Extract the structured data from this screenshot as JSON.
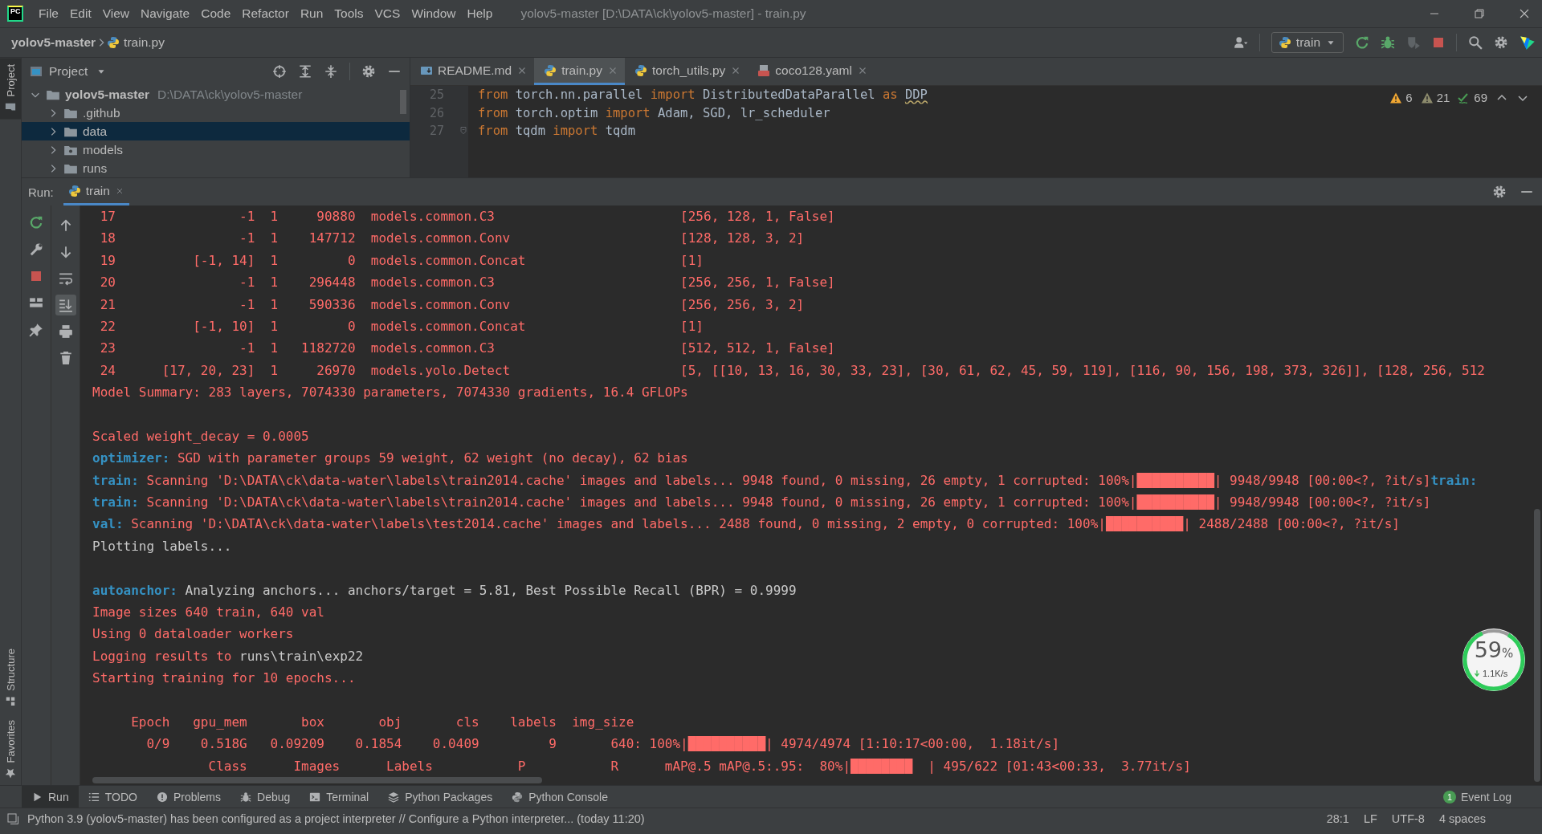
{
  "title_bar": {
    "app_icon": "PC",
    "menus": [
      "File",
      "Edit",
      "View",
      "Navigate",
      "Code",
      "Refactor",
      "Run",
      "Tools",
      "VCS",
      "Window",
      "Help"
    ],
    "title": "yolov5-master [D:\\DATA\\ck\\yolov5-master] - train.py"
  },
  "navigation_bar": {
    "project": "yolov5-master",
    "file": "train.py",
    "run_config": "train"
  },
  "side_tabs": [
    {
      "label": "Project",
      "selected": true
    },
    {
      "label": "Structure",
      "selected": false
    },
    {
      "label": "Favorites",
      "selected": false
    }
  ],
  "project_panel": {
    "title": "Project",
    "tree": [
      {
        "label": "yolov5-master",
        "path": "D:\\DATA\\ck\\yolov5-master",
        "kind": "folder",
        "expanded": true,
        "selected": false,
        "children": [
          {
            "label": ".github",
            "kind": "folder",
            "expanded": false,
            "selected": false
          },
          {
            "label": "data",
            "kind": "folder",
            "expanded": false,
            "selected": true
          },
          {
            "label": "models",
            "kind": "package",
            "expanded": false,
            "selected": false
          },
          {
            "label": "runs",
            "kind": "folder",
            "expanded": false,
            "selected": false
          }
        ]
      }
    ]
  },
  "editor": {
    "tabs": [
      {
        "label": "README.md",
        "kind": "markdown",
        "selected": false
      },
      {
        "label": "train.py",
        "kind": "python",
        "selected": true
      },
      {
        "label": "torch_utils.py",
        "kind": "python",
        "selected": false
      },
      {
        "label": "coco128.yaml",
        "kind": "yaml",
        "selected": false
      }
    ],
    "lines": [
      {
        "number": "25",
        "folded": false,
        "tokens": [
          {
            "text": "from",
            "kind": "keyword"
          },
          {
            "text": " torch.nn.parallel ",
            "kind": "name"
          },
          {
            "text": "import",
            "kind": "keyword"
          },
          {
            "text": " DistributedDataParallel ",
            "kind": "name"
          },
          {
            "text": "as",
            "kind": "keyword"
          },
          {
            "text": "DDP",
            "kind": "warning"
          }
        ]
      },
      {
        "number": "26",
        "folded": false,
        "tokens": [
          {
            "text": "from",
            "kind": "keyword"
          },
          {
            "text": " torch.optim ",
            "kind": "name"
          },
          {
            "text": "import",
            "kind": "keyword"
          },
          {
            "text": " Adam, SGD, lr_scheduler",
            "kind": "name"
          }
        ]
      },
      {
        "number": "27",
        "folded": true,
        "tokens": [
          {
            "text": "from",
            "kind": "keyword"
          },
          {
            "text": " tqdm ",
            "kind": "name"
          },
          {
            "text": "import",
            "kind": "keyword"
          },
          {
            "text": " tqdm",
            "kind": "name"
          }
        ]
      }
    ],
    "inspections": [
      {
        "count": "6",
        "kind": "warning"
      },
      {
        "count": "21",
        "kind": "weak"
      },
      {
        "count": "69",
        "kind": "ok"
      }
    ]
  },
  "run_panel": {
    "label": "Run:",
    "tabs": [
      {
        "label": "train",
        "selected": true
      }
    ]
  },
  "console_tools": [
    {
      "on": false
    },
    {
      "on": false
    },
    {
      "on": false
    },
    {
      "on": true
    },
    {
      "on": false
    },
    {
      "on": false
    }
  ],
  "console": {
    "lines": [
      {
        "kind": "layer",
        "index": "17",
        "from": "-1",
        "n": "1",
        "params": "90880",
        "module": "models.common.C3",
        "args": "[256, 128, 1, False]"
      },
      {
        "kind": "layer",
        "index": "18",
        "from": "-1",
        "n": "1",
        "params": "147712",
        "module": "models.common.Conv",
        "args": "[128, 128, 3, 2]"
      },
      {
        "kind": "layer",
        "index": "19",
        "from": "[-1, 14]",
        "n": "1",
        "params": "0",
        "module": "models.common.Concat",
        "args": "[1]"
      },
      {
        "kind": "layer",
        "index": "20",
        "from": "-1",
        "n": "1",
        "params": "296448",
        "module": "models.common.C3",
        "args": "[256, 256, 1, False]"
      },
      {
        "kind": "layer",
        "index": "21",
        "from": "-1",
        "n": "1",
        "params": "590336",
        "module": "models.common.Conv",
        "args": "[256, 256, 3, 2]"
      },
      {
        "kind": "layer",
        "index": "22",
        "from": "[-1, 10]",
        "n": "1",
        "params": "0",
        "module": "models.common.Concat",
        "args": "[1]"
      },
      {
        "kind": "layer",
        "index": "23",
        "from": "-1",
        "n": "1",
        "params": "1182720",
        "module": "models.common.C3",
        "args": "[512, 512, 1, False]"
      },
      {
        "kind": "layer",
        "index": "24",
        "from": "[17, 20, 23]",
        "n": "1",
        "params": "26970",
        "module": "models.yolo.Detect",
        "args": "[5, [[10, 13, 16, 30, 33, 23], [30, 61, 62, 45, 59, 119], [116, 90, 156, 198, 373, 326]], [128, 256, 512"
      },
      {
        "kind": "text",
        "segments": [
          {
            "text": "Model Summary: 283 layers, 7074330 parameters, 7074330 gradients, 16.4 GFLOPs",
            "kind": "error"
          }
        ]
      },
      {
        "kind": "blank"
      },
      {
        "kind": "text",
        "segments": [
          {
            "text": "Scaled weight_decay = 0.0005",
            "kind": "error"
          }
        ]
      },
      {
        "kind": "text",
        "segments": [
          {
            "text": "optimizer:",
            "kind": "info"
          },
          {
            "text": " SGD with parameter groups 59 weight, 62 weight (no decay), 62 bias",
            "kind": "error"
          }
        ]
      },
      {
        "kind": "text",
        "segments": [
          {
            "text": "train:",
            "kind": "info"
          },
          {
            "text": " Scanning 'D:\\DATA\\ck\\data-water\\labels\\train2014.cache' images and labels... 9948 found, 0 missing, 26 empty, 1 corrupted: 100%|██████████| 9948/9948 [00:00<?, ?it/s]",
            "kind": "error"
          },
          {
            "text": "train:",
            "kind": "info"
          }
        ]
      },
      {
        "kind": "text",
        "segments": [
          {
            "text": "train:",
            "kind": "info"
          },
          {
            "text": " Scanning 'D:\\DATA\\ck\\data-water\\labels\\train2014.cache' images and labels... 9948 found, 0 missing, 26 empty, 1 corrupted: 100%|██████████| 9948/9948 [00:00<?, ?it/s]",
            "kind": "error"
          }
        ]
      },
      {
        "kind": "text",
        "segments": [
          {
            "text": "val:",
            "kind": "info"
          },
          {
            "text": " Scanning 'D:\\DATA\\ck\\data-water\\labels\\test2014.cache' images and labels... 2488 found, 0 missing, 2 empty, 0 corrupted: 100%|██████████| 2488/2488 [00:00<?, ?it/s]",
            "kind": "error"
          }
        ]
      },
      {
        "kind": "text",
        "segments": [
          {
            "text": "Plotting labels...",
            "kind": "plain"
          }
        ]
      },
      {
        "kind": "blank"
      },
      {
        "kind": "text",
        "segments": [
          {
            "text": "autoanchor:",
            "kind": "info"
          },
          {
            "text": " Analyzing anchors... anchors/target = 5.81, Best Possible Recall (BPR) = 0.9999",
            "kind": "plain"
          }
        ]
      },
      {
        "kind": "text",
        "segments": [
          {
            "text": "Image sizes 640 train, 640 val",
            "kind": "error"
          }
        ]
      },
      {
        "kind": "text",
        "segments": [
          {
            "text": "Using 0 dataloader workers",
            "kind": "error"
          }
        ]
      },
      {
        "kind": "text",
        "segments": [
          {
            "text": "Logging results to ",
            "kind": "error"
          },
          {
            "text": "runs\\train\\exp22",
            "kind": "plain"
          }
        ]
      },
      {
        "kind": "text",
        "segments": [
          {
            "text": "Starting training for 10 epochs...",
            "kind": "error"
          }
        ]
      },
      {
        "kind": "blank"
      },
      {
        "kind": "text",
        "segments": [
          {
            "text": "     Epoch   gpu_mem       box       obj       cls    labels  img_size",
            "kind": "error"
          }
        ]
      },
      {
        "kind": "text",
        "segments": [
          {
            "text": "       0/9    0.518G   0.09209    0.1854    0.0409         9       640: 100%|██████████| 4974/4974 [1:10:17<00:00,  1.18it/s]",
            "kind": "error"
          }
        ]
      },
      {
        "kind": "text",
        "segments": [
          {
            "text": "               Class      Images      Labels           P           R      mAP@.5 mAP@.5:.95:  80%|████████  | 495/622 [01:43<00:33,  3.77it/s]",
            "kind": "error"
          }
        ]
      }
    ]
  },
  "network_meter": {
    "percent": "59",
    "unit": "%",
    "speed": "1.1K/s"
  },
  "tool_tabs": [
    {
      "label": "Run",
      "selected": true
    },
    {
      "label": "TODO",
      "selected": false
    },
    {
      "label": "Problems",
      "selected": false
    },
    {
      "label": "Debug",
      "selected": false
    },
    {
      "label": "Terminal",
      "selected": false
    },
    {
      "label": "Python Packages",
      "selected": false
    },
    {
      "label": "Python Console",
      "selected": false
    }
  ],
  "event_log": {
    "label": "Event Log",
    "count": "1"
  },
  "status_bar": {
    "message": "Python 3.9 (yolov5-master) has been configured as a project interpreter // Configure a Python interpreter... (today 11:20)",
    "items": [
      "28:1",
      "LF",
      "UTF-8",
      "4 spaces"
    ]
  }
}
